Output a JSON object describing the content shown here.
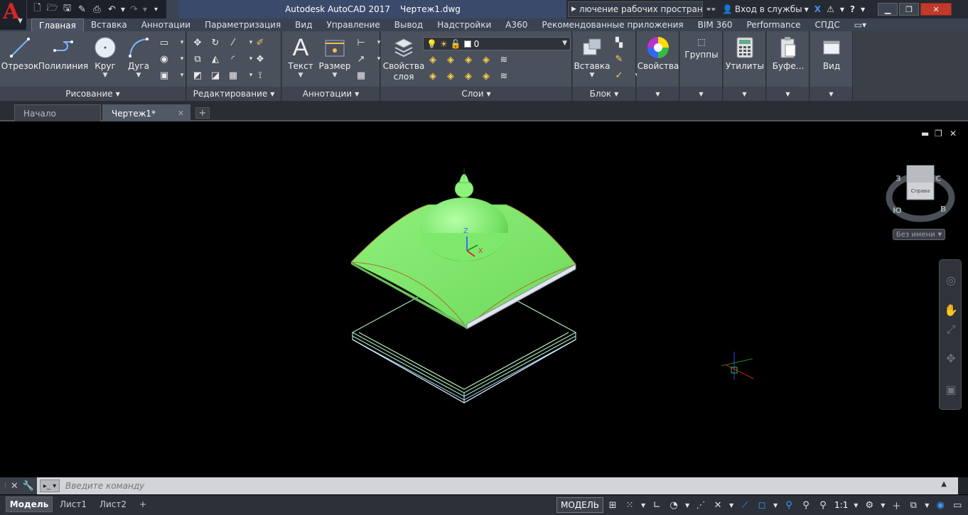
{
  "app": {
    "logo_letter": "A",
    "title": "Autodesk AutoCAD 2017",
    "filename": "Чертеж1.dwg",
    "workspace_switch": "лючение рабочих пространств",
    "signin": "Вход в службы"
  },
  "ribbon_tabs": [
    "Главная",
    "Вставка",
    "Аннотации",
    "Параметризация",
    "Вид",
    "Управление",
    "Вывод",
    "Надстройки",
    "A360",
    "Рекомендованные приложения",
    "BIM 360",
    "Performance",
    "СПДС"
  ],
  "ribbon": {
    "draw": {
      "title": "Рисование",
      "line": "Отрезок",
      "polyline": "Полилиния",
      "circle": "Круг",
      "arc": "Дуга"
    },
    "modify": {
      "title": "Редактирование"
    },
    "annotation": {
      "title": "Аннотации",
      "text": "Текст",
      "dimension": "Размер"
    },
    "layers": {
      "title": "Слои",
      "properties": "Свойства\nслоя",
      "properties_line1": "Свойства",
      "properties_line2": "слоя",
      "current_layer": "0"
    },
    "block": {
      "title": "Блок",
      "insert": "Вставка"
    },
    "properties": "Свойства",
    "groups": "Группы",
    "utilities": "Утилиты",
    "clipboard": "Буфе...",
    "view": "Вид"
  },
  "file_tabs": {
    "start": "Начало",
    "drawing": "Чертеж1*",
    "new_tab": "+"
  },
  "viewport": {
    "viewcube_face": "Справа",
    "compass": {
      "n": "С",
      "s": "Ю",
      "e": "В",
      "w": "З"
    },
    "named_view": "Без имени",
    "ucs": {
      "z": "Z",
      "x": "X"
    }
  },
  "command_line": {
    "placeholder": "Введите команду"
  },
  "layout_tabs": [
    "Модель",
    "Лист1",
    "Лист2"
  ],
  "status": {
    "model": "МОДЕЛЬ",
    "scale": "1:1"
  },
  "colors": {
    "roof_green": "#7eea6b",
    "roof_shade": "#5fc24f",
    "frame_line": "#9ad7ff",
    "accent_blue": "#3f96ff",
    "logo_red": "#d9262a"
  }
}
